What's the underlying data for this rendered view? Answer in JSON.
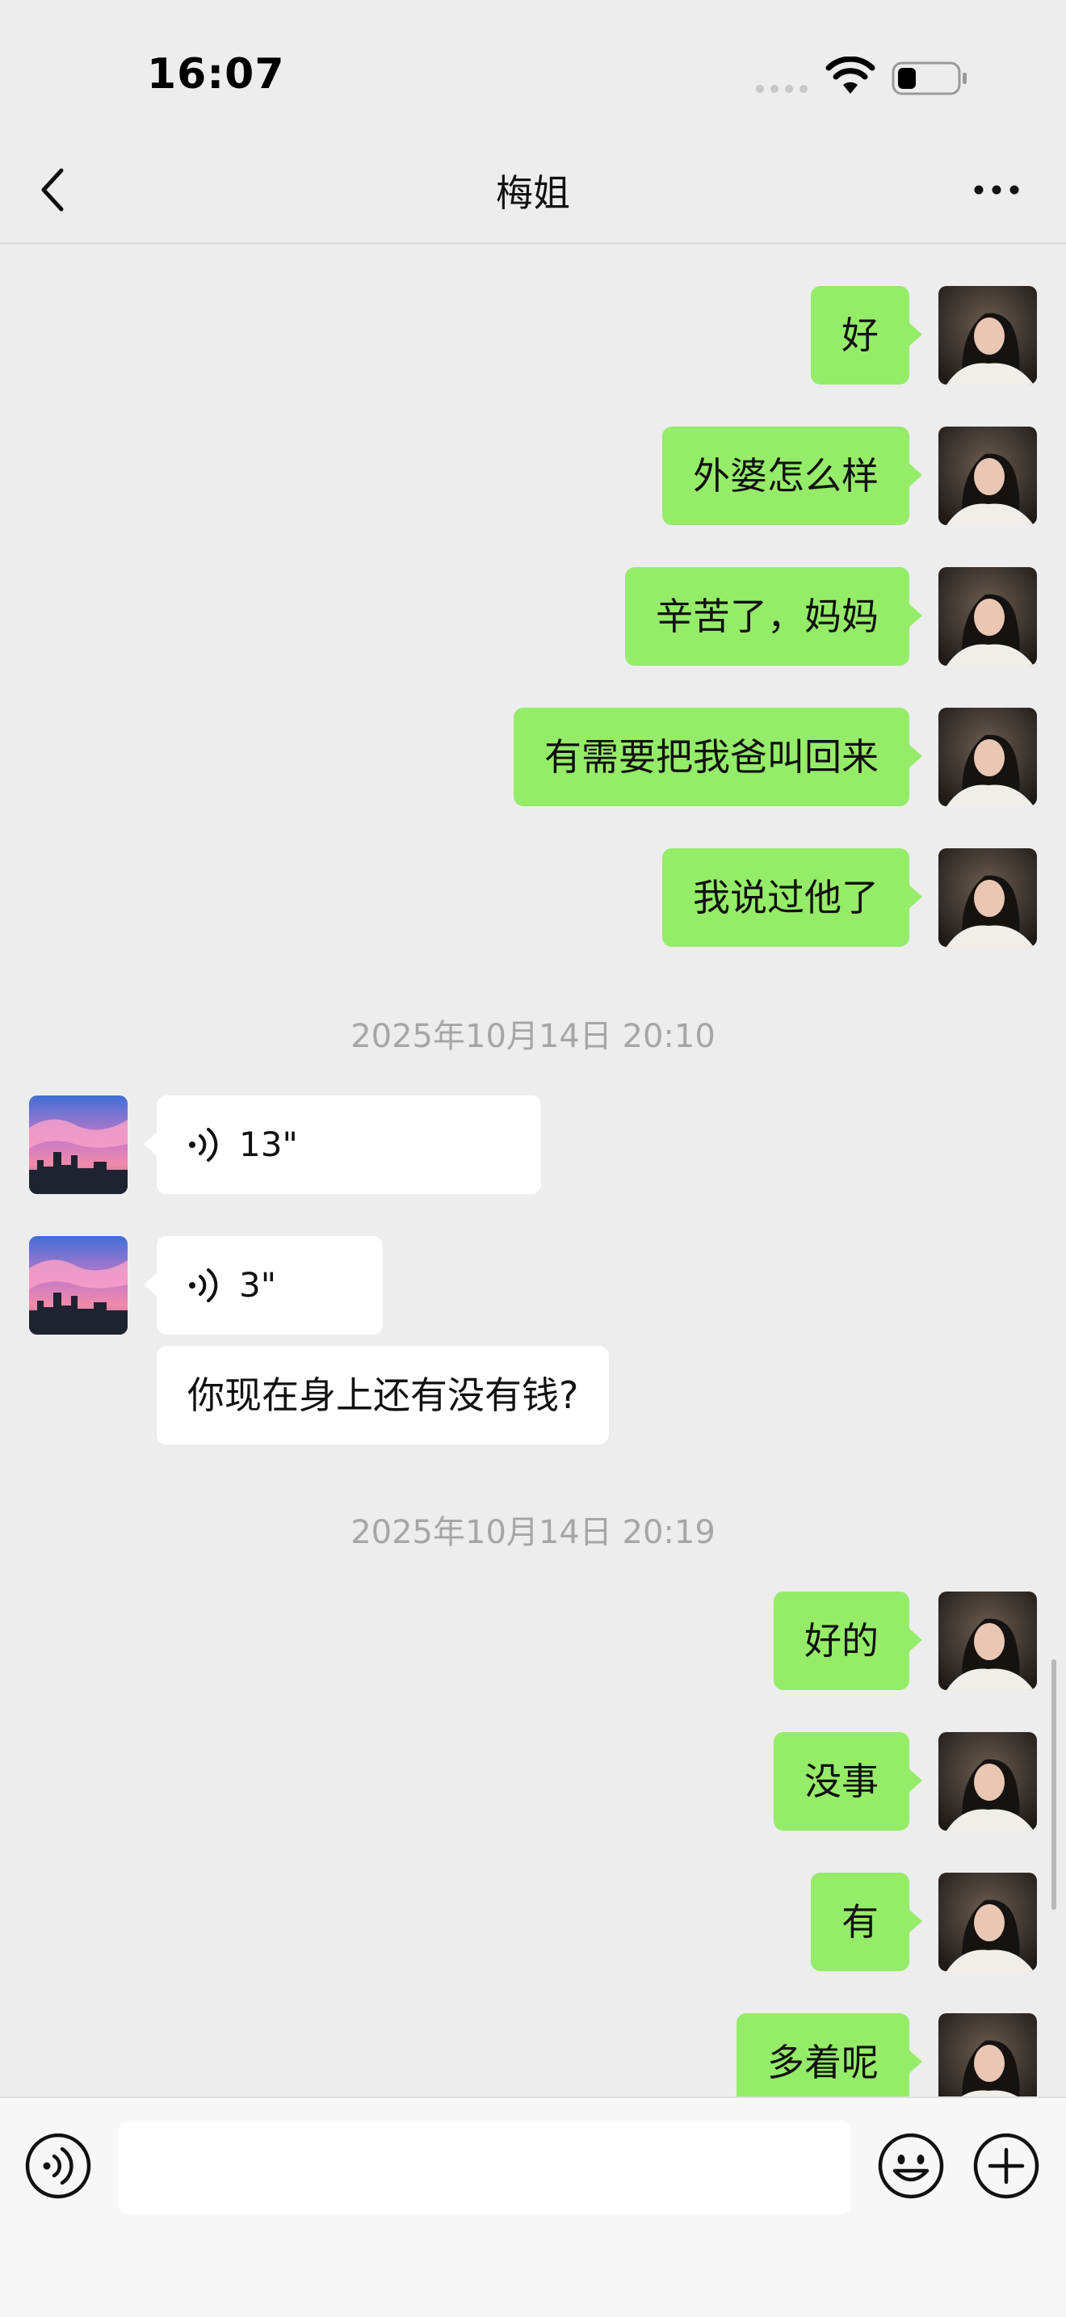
{
  "status_bar": {
    "time": "16:07"
  },
  "nav": {
    "title": "梅姐",
    "back_icon": "chevron-left-icon",
    "more_icon": "ellipsis-icon"
  },
  "colors": {
    "outgoing_bubble": "#95EC69",
    "incoming_bubble": "#FFFFFF",
    "background": "#EDEDED",
    "timestamp_text": "#A6A6A6"
  },
  "messages": [
    {
      "direction": "out",
      "type": "text",
      "text": "好"
    },
    {
      "direction": "out",
      "type": "text",
      "text": "外婆怎么样"
    },
    {
      "direction": "out",
      "type": "text",
      "text": "辛苦了，妈妈"
    },
    {
      "direction": "out",
      "type": "text",
      "text": "有需要把我爸叫回来"
    },
    {
      "direction": "out",
      "type": "text",
      "text": "我说过他了"
    },
    {
      "type": "timestamp",
      "text": "2025年10月14日 20:10"
    },
    {
      "direction": "in",
      "type": "voice",
      "duration": "13\""
    },
    {
      "direction": "in",
      "type": "voice",
      "duration": "3\""
    },
    {
      "direction": "in",
      "type": "text",
      "text": "你现在身上还有没有钱?"
    },
    {
      "type": "timestamp",
      "text": "2025年10月14日 20:19"
    },
    {
      "direction": "out",
      "type": "text",
      "text": "好的"
    },
    {
      "direction": "out",
      "type": "text",
      "text": "没事"
    },
    {
      "direction": "out",
      "type": "text",
      "text": "有"
    },
    {
      "direction": "out",
      "type": "text",
      "text": "多着呢"
    }
  ],
  "input_bar": {
    "input_value": "",
    "voice_icon": "voice-mode-icon",
    "emoji_icon": "emoji-icon",
    "plus_icon": "plus-icon"
  }
}
